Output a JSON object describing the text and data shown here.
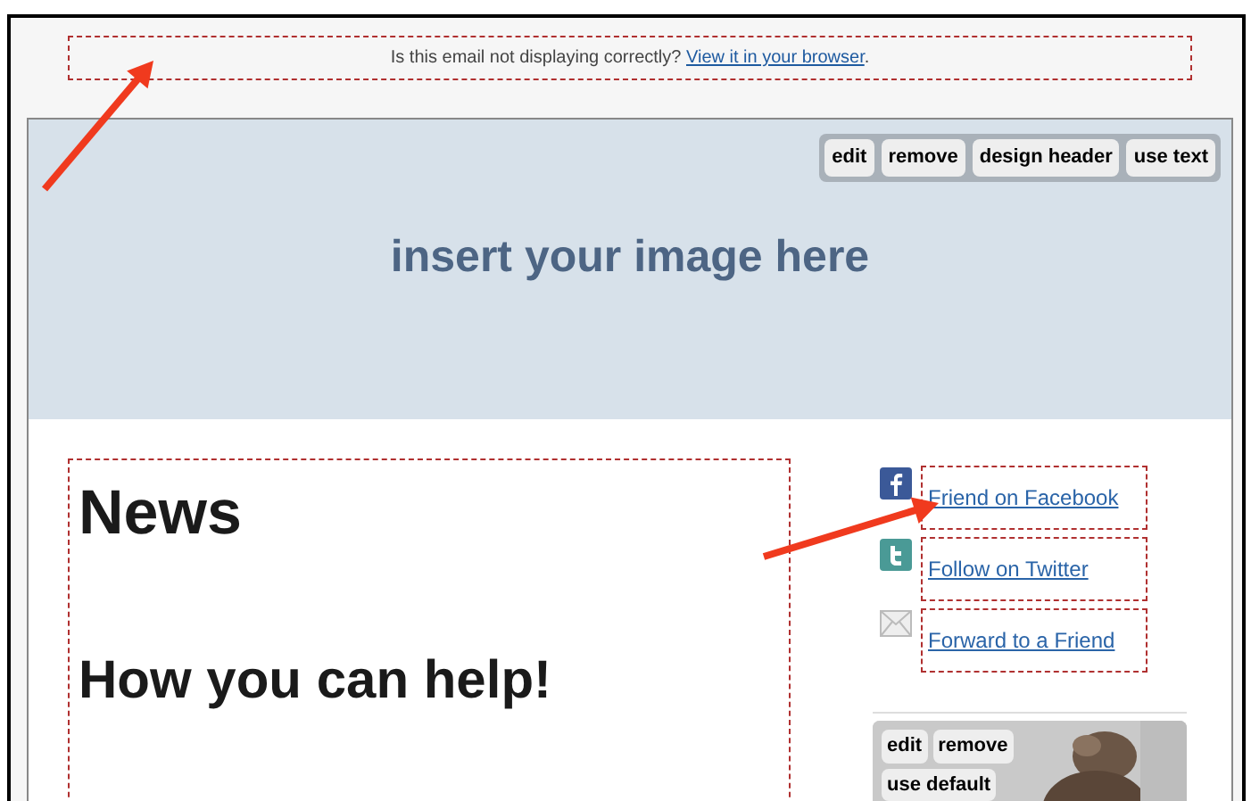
{
  "preheader": {
    "text": "Is this email not displaying correctly?",
    "link": "View it in your browser",
    "after": "."
  },
  "header": {
    "buttons": [
      "edit",
      "remove",
      "design header",
      "use text"
    ],
    "placeholder": "insert your image here"
  },
  "content": {
    "headings": [
      "News",
      "How you can help!"
    ]
  },
  "social": [
    {
      "kind": "facebook",
      "label": "Friend on Facebook"
    },
    {
      "kind": "twitter",
      "label": "Follow on Twitter"
    },
    {
      "kind": "email",
      "label": "Forward to a Friend"
    }
  ],
  "sidebar_image": {
    "buttons": [
      "edit",
      "remove",
      "use default"
    ]
  }
}
